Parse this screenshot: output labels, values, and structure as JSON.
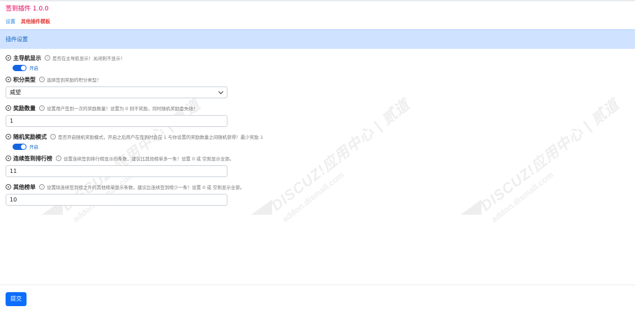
{
  "header": {
    "plugin_title": "签到插件 1.0.0",
    "nav": {
      "settings": "设置",
      "other_templates": "其他插件模板"
    }
  },
  "section": {
    "title": "插件设置"
  },
  "fields": [
    {
      "label": "主导航显示",
      "hint": "是否在主导航显示！关闭则不显示！",
      "type": "toggle",
      "state": "开启"
    },
    {
      "label": "积分类型",
      "hint": "选择签到奖励的积分类型！",
      "type": "select",
      "value": "威望"
    },
    {
      "label": "奖励数量",
      "hint": "设置用户签到一次的奖励数量！设置为 0 则不奖励，同时随机奖励会失效！",
      "type": "text",
      "value": "1"
    },
    {
      "label": "随机奖励模式",
      "hint": "是否开启随机奖励模式，开启之后用户在签到时会在 1 与你设置的奖励数量之间随机获得！最少奖励 1",
      "type": "toggle",
      "state": "开启"
    },
    {
      "label": "连续签到排行榜",
      "hint": "设置连续签到排行榜显示的条数，建议比其他榜单多一条！设置 0 或 空则显示全部。",
      "type": "text",
      "value": "11"
    },
    {
      "label": "其他榜单",
      "hint": "设置除连续签到榜之外的其他榜单显示条数，建议比连续签到榜少一条！设置 0 或 空则显示全部。",
      "type": "text",
      "value": "10"
    }
  ],
  "footer": {
    "submit_label": "提交"
  },
  "watermark": {
    "line1": "DISCUZ!应用中心 | 贰道",
    "line2": "addon.dismall.com"
  },
  "colors": {
    "accent": "#0d6efd",
    "title": "#e6005c",
    "section_bg": "#cfe2ff"
  }
}
